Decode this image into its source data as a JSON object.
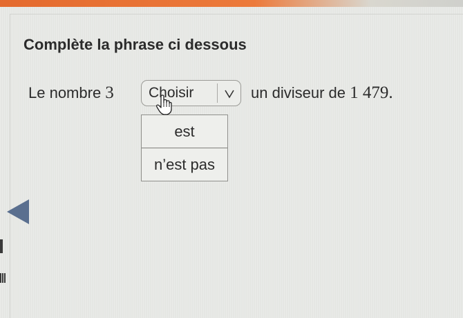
{
  "exercise": {
    "title": "Complète la phrase ci dessous",
    "sentence_before_text": "Le nombre ",
    "sentence_number": "3",
    "sentence_after_text": "un diviseur de ",
    "sentence_after_number": "1 479.",
    "dropdown": {
      "placeholder": "Choisir",
      "arrow_glyph": "v",
      "options": [
        "est",
        "n’est pas"
      ]
    }
  },
  "colors": {
    "top_bar": "#e46a2e",
    "background": "#e8e9e6",
    "text": "#2b2b2b"
  },
  "icons": {
    "dropdown_arrow": "chevron-down-icon",
    "cursor": "hand-pointer-icon",
    "nav": "caret-left-icon"
  }
}
